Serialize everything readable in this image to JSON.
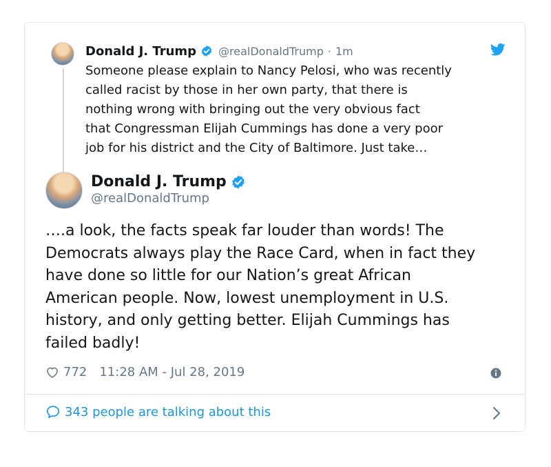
{
  "quoted_tweet": {
    "name": "Donald J. Trump",
    "handle": "@realDonaldTrump",
    "separator": "·",
    "time": "1m",
    "text": "Someone please explain to Nancy Pelosi, who was recently\ncalled racist by those in her own party, that there is\nnothing wrong with bringing out the very obvious fact\nthat Congressman Elijah Cummings has done a very poor\njob for his district and the City of Baltimore. Just take…",
    "avatar_icon": "profile-photo",
    "verified_icon": "verified-badge-icon",
    "brand_icon": "twitter-bird-icon"
  },
  "main_tweet": {
    "name": "Donald J. Trump",
    "handle": "@realDonaldTrump",
    "text": "….a look, the facts speak far louder than words! The\nDemocrats always play the Race Card, when in fact they\nhave done so little for our Nation’s great African\nAmerican people. Now, lowest unemployment in U.S.\nhistory, and only getting better. Elijah Cummings has\nfailed badly!",
    "likes": "772",
    "timestamp": "11:28 AM - Jul 28, 2019"
  },
  "footer": {
    "talking_label": "343 people are talking about this"
  },
  "colors": {
    "accent": "#1da1f2",
    "link": "#1b95e0",
    "secondary_text": "#657786",
    "border": "#e1e8ed"
  }
}
